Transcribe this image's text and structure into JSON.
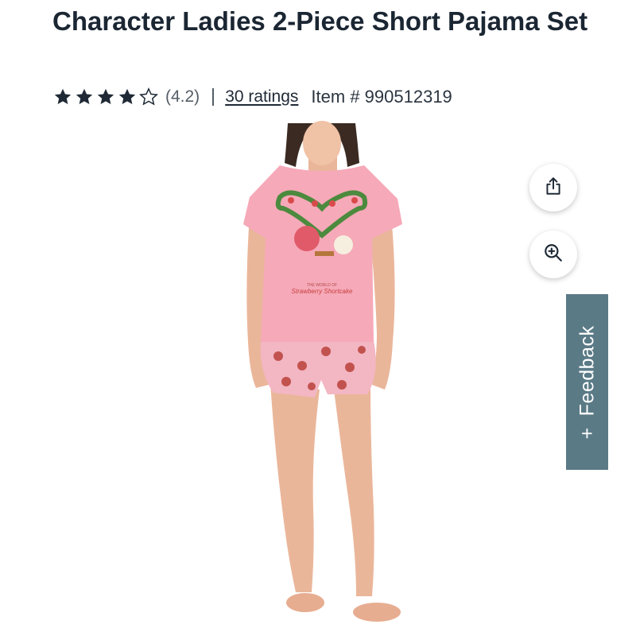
{
  "product": {
    "title": "Character Ladies 2-Piece Short Pajama Set",
    "rating_value": 4.2,
    "rating_text": "(4.2)",
    "ratings_link": "30 ratings",
    "item_number": "Item # 990512319"
  },
  "shirt_print": {
    "line1": "THE WORLD OF",
    "line2": "Strawberry Shortcake"
  },
  "actions": {
    "share_icon": "share-icon",
    "zoom_icon": "zoom-in-icon"
  },
  "feedback": {
    "label": "Feedback",
    "plus": "+"
  },
  "colors": {
    "text": "#1b2633",
    "feedback_bg": "#5a7a86",
    "shirt_pink": "#f6a9b8"
  }
}
